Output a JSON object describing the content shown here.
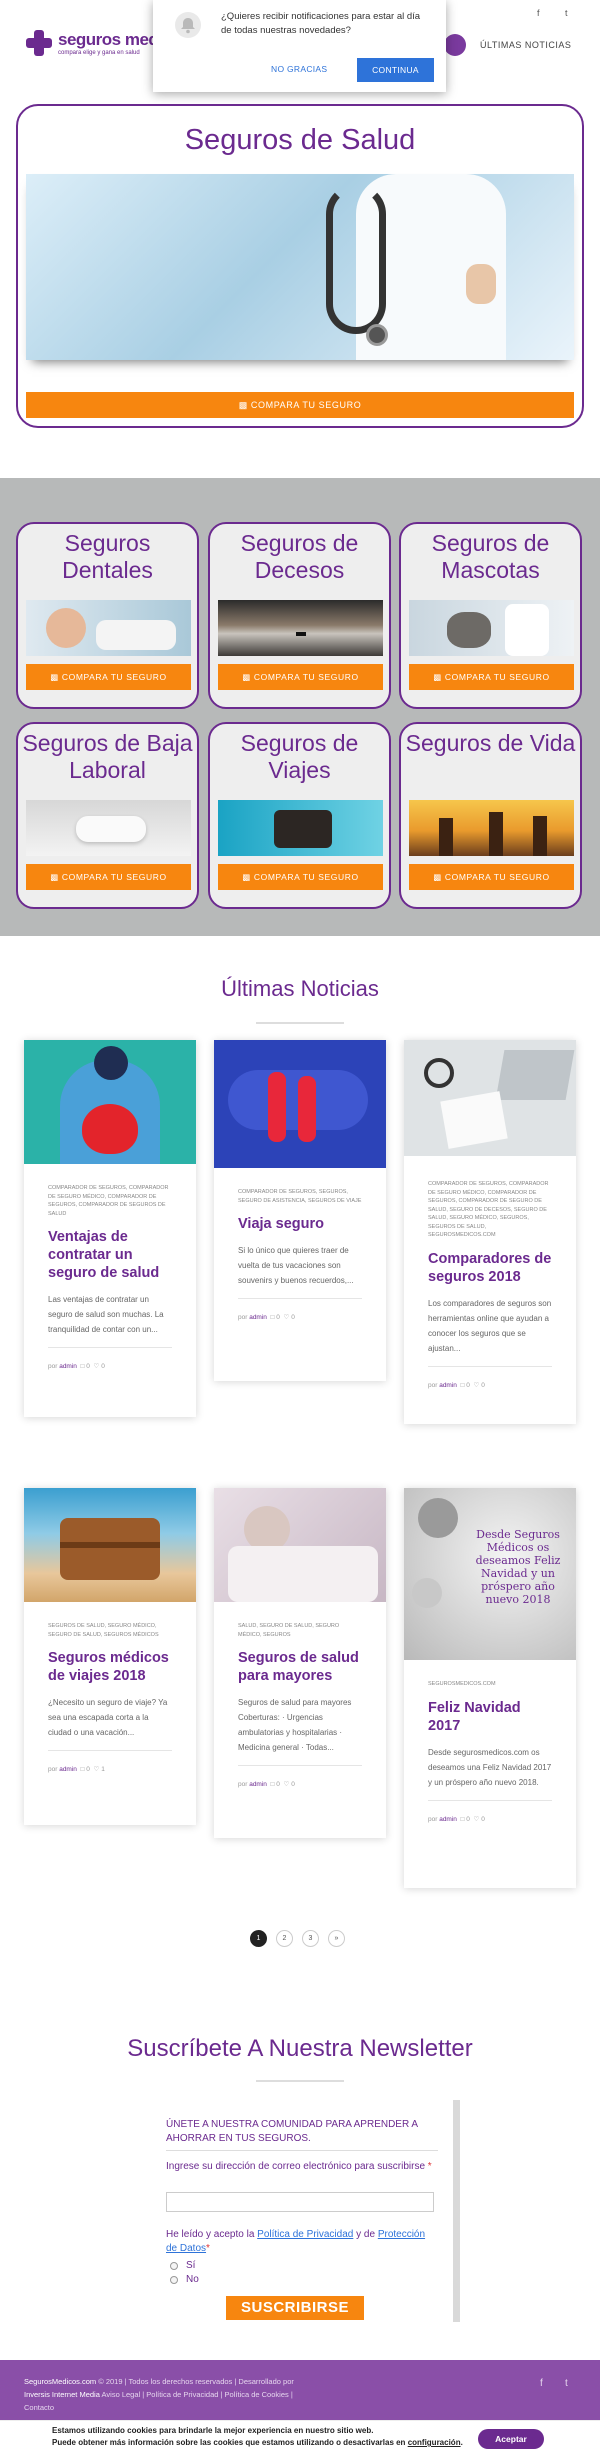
{
  "header": {
    "logo_title": "seguros medicos.com",
    "logo_tagline": "compara elige y gana en salud",
    "nav_news": "ÚLTIMAS NOTICIAS",
    "social_fb": "f",
    "social_tw": "t"
  },
  "notification": {
    "text": "¿Quieres recibir notificaciones para estar al día de todas nuestras novedades?",
    "no_label": "NO GRACIAS",
    "yes_label": "CONTINUA"
  },
  "hero": {
    "title": "Seguros de Salud",
    "cta": "COMPARA TU SEGURO"
  },
  "products": [
    {
      "title": "Seguros Dentales",
      "cta": "COMPARA TU SEGURO"
    },
    {
      "title": "Seguros de Decesos",
      "cta": "COMPARA TU SEGURO"
    },
    {
      "title": "Seguros de Mascotas",
      "cta": "COMPARA TU SEGURO"
    },
    {
      "title": "Seguros de Baja Laboral",
      "cta": "COMPARA TU SEGURO"
    },
    {
      "title": "Seguros de Viajes",
      "cta": "COMPARA TU SEGURO"
    },
    {
      "title": "Seguros de Vida",
      "cta": "COMPARA TU SEGURO"
    }
  ],
  "news": {
    "title": "Últimas Noticias",
    "posts": [
      {
        "cats": "COMPARADOR DE SEGUROS, COMPARADOR DE SEGURO MÉDICO, COMPARADOR DE SEGUROS, COMPARADOR DE SEGUROS DE SALUD",
        "title": "Ventajas de contratar un seguro de salud",
        "excerpt": "Las ventajas de contratar un seguro de salud son muchas. La tranquilidad de contar con un...",
        "author": "admin",
        "comments": "0",
        "likes": "0"
      },
      {
        "cats": "COMPARADOR DE SEGUROS, SEGUROS, SEGURO DE ASISTENCIA, SEGUROS DE VIAJE",
        "title": "Viaja seguro",
        "excerpt": "Si lo único que quieres traer de vuelta de tus vacaciones son souvenirs y buenos recuerdos,...",
        "author": "admin",
        "comments": "0",
        "likes": "0"
      },
      {
        "cats": "COMPARADOR DE SEGUROS, COMPARADOR DE SEGURO MÉDICO, COMPARADOR DE SEGUROS, COMPARADOR DE SEGURO DE SALUD, SEGURO DE DECESOS, SEGURO DE SALUD, SEGURO MÉDICO, SEGUROS, SEGUROS DE SALUD, SEGUROSMEDICOS.COM",
        "title": "Comparadores de seguros 2018",
        "excerpt": "Los comparadores de seguros son herramientas online que ayudan a conocer los seguros que se ajustan...",
        "author": "admin",
        "comments": "0",
        "likes": "0"
      },
      {
        "cats": "SEGUROS DE SALUD, SEGURO MÉDICO, SEGURO DE SALUD, SEGUROS MÉDICOS",
        "title": "Seguros médicos de viajes 2018",
        "excerpt": "¿Necesito un seguro de viaje? Ya sea una escapada corta a la ciudad o una vacación...",
        "author": "admin",
        "comments": "0",
        "likes": "1"
      },
      {
        "cats": "SALUD, SEGURO DE SALUD, SEGURO MÉDICO, SEGUROS",
        "title": "Seguros de salud para mayores",
        "excerpt": "Seguros de salud para mayores Coberturas: · Urgencias ambulatorias y hospitalarias · Medicina general · Todas...",
        "author": "admin",
        "comments": "0",
        "likes": "0"
      },
      {
        "cats": "SEGUROSMEDICOS.COM",
        "title": "Feliz Navidad 2017",
        "excerpt": "Desde segurosmedicos.com os deseamos una Feliz Navidad 2017 y un próspero año nuevo 2018.",
        "author": "admin",
        "comments": "0",
        "likes": "0",
        "image_text": "Desde Seguros Médicos os deseamos Feliz Navidad y un próspero año nuevo 2018"
      }
    ]
  },
  "pager": [
    "1",
    "2",
    "3",
    "»"
  ],
  "newsletter": {
    "title": "Suscríbete A Nuestra Newsletter",
    "heading": "ÚNETE A NUESTRA COMUNIDAD PARA APRENDER A AHORRAR EN TUS SEGUROS.",
    "email_label": "Ingrese su dirección de correo electrónico para suscribirse",
    "required_mark": "*",
    "consent_prefix": "He leído y acepto la",
    "privacy_link": "Política de Privacidad",
    "consent_and": "y de",
    "data_link": "Protección de Datos",
    "option_yes": "Sí",
    "option_no": "No",
    "submit": "SUSCRIBIRSE"
  },
  "footer": {
    "site": "SegurosMedicos.com",
    "rights": "© 2019 | Todos los derechos reservados | Desarrollado por",
    "dev": "Inversis Internet Media",
    "links": "Aviso Legal | Política de Privacidad | Política de Cookies | Contacto",
    "social_fb": "f",
    "social_tw": "t"
  },
  "cookie": {
    "line1": "Estamos utilizando cookies para brindarle la mejor experiencia en nuestro sitio web.",
    "line2": "Puede obtener más información sobre las cookies que estamos utilizando o desactivarlas en",
    "config_link": "configuración",
    "accept": "Aceptar"
  },
  "colors": {
    "brand_purple": "#6b2a8f",
    "cta_orange": "#f7860f",
    "notif_blue": "#2e73d9",
    "section_grey": "#b7b9b9"
  },
  "icons": [
    "bell-icon",
    "chart-icon",
    "comment-icon",
    "heart-icon",
    "facebook-icon",
    "twitter-icon"
  ]
}
